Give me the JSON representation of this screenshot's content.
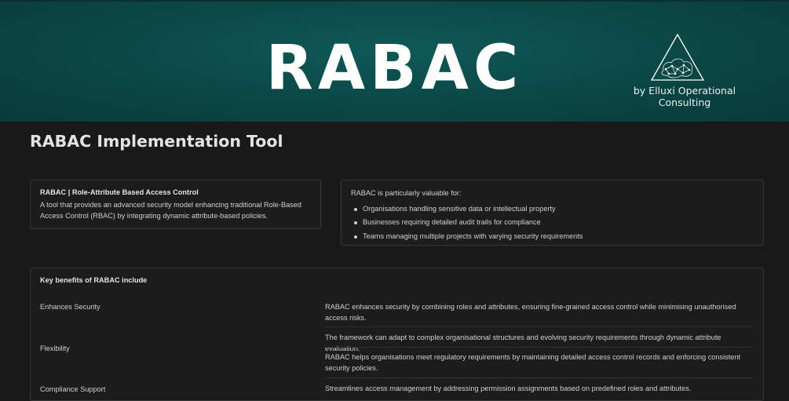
{
  "banner": {
    "title": "RABAC",
    "byline": "by Elluxi Operational Consulting",
    "logo_icon": "triangle-network-logo"
  },
  "page": {
    "title": "RABAC Implementation Tool"
  },
  "intro_card": {
    "title": "RABAC | Role-Attribute Based Access Control",
    "description": "A tool that provides an advanced security model enhancing traditional Role-Based Access Control (RBAC) by integrating dynamic attribute-based policies."
  },
  "valuable_card": {
    "intro": "RABAC is particularly valuable for:",
    "items": [
      "Organisations handling sensitive data or intellectual property",
      "Businesses requiring detailed audit trails for compliance",
      "Teams managing multiple projects with varying security requirements"
    ]
  },
  "benefits": {
    "title": "Key benefits of RABAC include",
    "rows": [
      {
        "label": "Enhances Security",
        "descriptions": [
          "RABAC enhances security by combining roles and attributes, ensuring fine-grained access control while minimising unauthorised access risks."
        ]
      },
      {
        "label": "Flexibility",
        "descriptions": [
          "The framework can adapt to complex organisational structures and evolving security requirements through dynamic attribute evaluation.",
          "RABAC helps organisations meet regulatory requirements by maintaining detailed access control records and enforcing consistent security policies."
        ]
      },
      {
        "label": "Compliance Support",
        "descriptions": [
          "Streamlines access management by addressing permission assignments based on predefined roles and attributes."
        ]
      }
    ]
  }
}
